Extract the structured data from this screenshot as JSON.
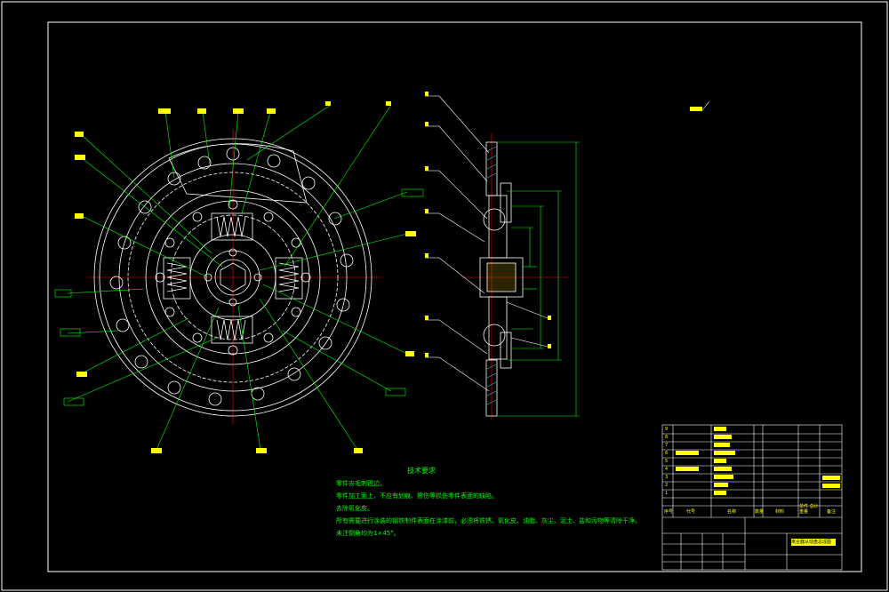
{
  "notes": {
    "title": "技术要求",
    "items": [
      "零件去毛刺锐边。",
      "零件加工面上，不应有划痕、擦伤等损伤零件表面的缺陷。",
      "去除氧化皮。",
      "所有需要进行涂装的钢铁制件表面在涂漆前，必须将铁锈、氧化皮、油脂、灰尘、泥土、盐和污物等清除干净。",
      "未注倒角均为1×45°。"
    ]
  },
  "title_block": {
    "rows": [
      "1",
      "2",
      "3",
      "4",
      "5",
      "6",
      "7",
      "8",
      "9"
    ],
    "headers": [
      "序号",
      "代号",
      "名称",
      "数量",
      "材料",
      "单件 总计 重量",
      "备注"
    ],
    "drawing_name": "离合器从动盘总成图"
  },
  "colors": {
    "background": "#000000",
    "frame": "#ffffff",
    "outline": "#ffffff",
    "center_line": "#ff0000",
    "leader": "#00ff00",
    "dimension": "#00ff00",
    "label": "#ffff00",
    "hatch": "#00ffff"
  }
}
